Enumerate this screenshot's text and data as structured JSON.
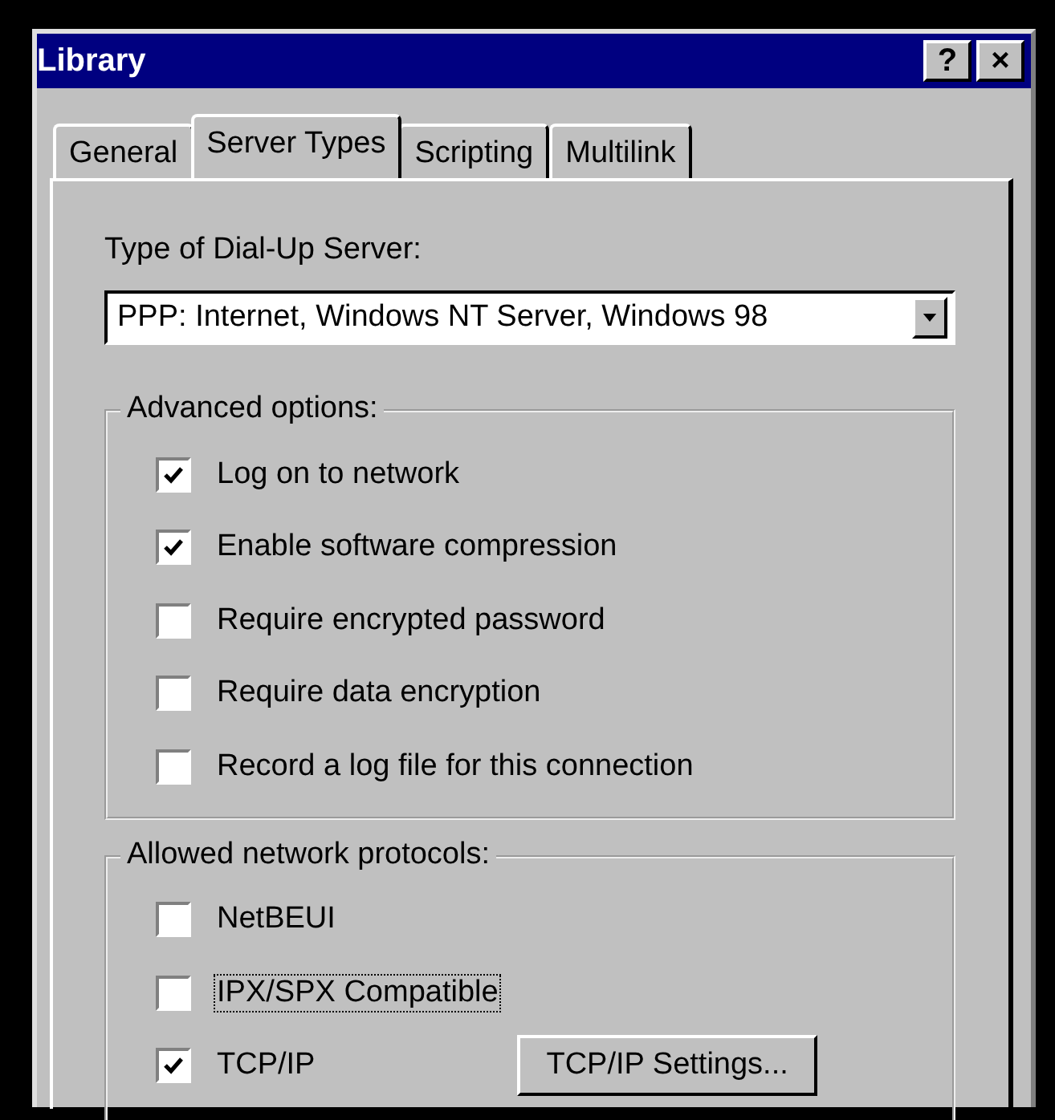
{
  "window": {
    "title": "Library",
    "help_button": "?",
    "close_button": "×"
  },
  "tabs": [
    {
      "label": "General",
      "selected": false
    },
    {
      "label": "Server Types",
      "selected": true
    },
    {
      "label": "Scripting",
      "selected": false
    },
    {
      "label": "Multilink",
      "selected": false
    }
  ],
  "server_type": {
    "label": "Type of Dial-Up Server:",
    "value": "PPP: Internet, Windows NT Server, Windows 98"
  },
  "advanced_options": {
    "title": "Advanced options:",
    "items": [
      {
        "label": "Log on to network",
        "checked": true
      },
      {
        "label": "Enable software compression",
        "checked": true
      },
      {
        "label": "Require encrypted password",
        "checked": false
      },
      {
        "label": "Require data encryption",
        "checked": false
      },
      {
        "label": "Record a log file for this connection",
        "checked": false
      }
    ]
  },
  "protocols": {
    "title": "Allowed network protocols:",
    "items": [
      {
        "label": "NetBEUI",
        "checked": false,
        "focused": false
      },
      {
        "label": "IPX/SPX Compatible",
        "checked": false,
        "focused": true
      },
      {
        "label": "TCP/IP",
        "checked": true,
        "focused": false
      }
    ],
    "settings_button": "TCP/IP Settings..."
  }
}
